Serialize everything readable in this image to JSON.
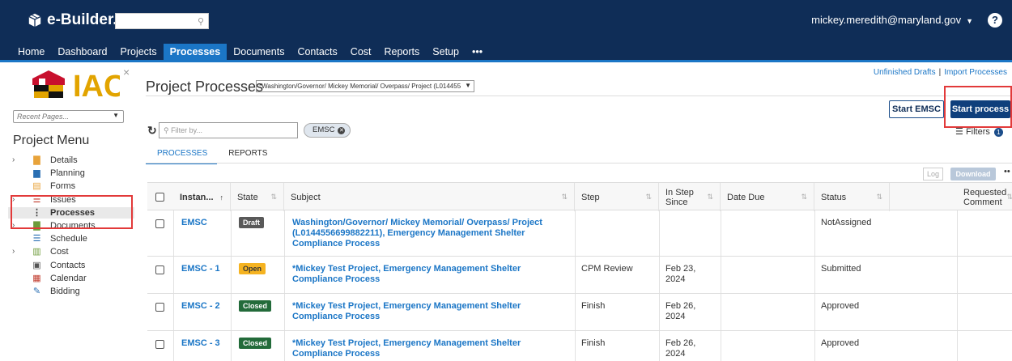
{
  "topbar": {
    "brand": "e-Builder.",
    "user": "mickey.meredith@maryland.gov",
    "help": "?"
  },
  "nav": {
    "tabs": [
      "Home",
      "Dashboard",
      "Projects",
      "Processes",
      "Documents",
      "Contacts",
      "Cost",
      "Reports",
      "Setup",
      "•••"
    ],
    "active": "Processes"
  },
  "sidebar": {
    "logo_text": "IAC",
    "recent_placeholder": "Recent Pages...",
    "menu_title": "Project Menu",
    "items": [
      {
        "label": "Details",
        "expandable": true,
        "icon": "folder-icon"
      },
      {
        "label": "Planning",
        "expandable": false,
        "icon": "planning-icon"
      },
      {
        "label": "Forms",
        "expandable": false,
        "icon": "forms-icon"
      },
      {
        "label": "Issues",
        "expandable": true,
        "icon": "issues-icon"
      },
      {
        "label": "Processes",
        "expandable": false,
        "icon": "processes-icon",
        "active": true
      },
      {
        "label": "Documents",
        "expandable": true,
        "icon": "documents-icon"
      },
      {
        "label": "Schedule",
        "expandable": false,
        "icon": "schedule-icon"
      },
      {
        "label": "Cost",
        "expandable": true,
        "icon": "cost-icon"
      },
      {
        "label": "Contacts",
        "expandable": false,
        "icon": "contacts-icon"
      },
      {
        "label": "Calendar",
        "expandable": false,
        "icon": "calendar-icon"
      },
      {
        "label": "Bidding",
        "expandable": false,
        "icon": "bidding-icon"
      }
    ]
  },
  "main": {
    "links": {
      "drafts": "Unfinished Drafts",
      "import": "Import Processes"
    },
    "title": "Project Processes",
    "project_select": "*Washington/Governor/ Mickey Memorial/ Overpass/ Project (L014455",
    "btn_start_emsc": "Start EMSC",
    "btn_start_process": "Start process",
    "filters_label": "Filters",
    "filters_count": "1",
    "filter_placeholder": "Filter by...",
    "chip_label": "EMSC",
    "subtabs": [
      "PROCESSES",
      "REPORTS"
    ],
    "btn_log": "Log",
    "btn_download": "Download",
    "more": "••"
  },
  "table": {
    "columns": [
      "Instan...",
      "State",
      "Subject",
      "Step",
      "In Step Since",
      "Date Due",
      "Status",
      "Requested Comment"
    ],
    "rows": [
      {
        "instance": "EMSC",
        "state": "Draft",
        "subject": "Washington/Governor/ Mickey Memorial/ Overpass/ Project (L0144556699882211), Emergency Management Shelter Compliance Process",
        "step": "",
        "since": "",
        "due": "",
        "status": "NotAssigned",
        "comment": ""
      },
      {
        "instance": "EMSC - 1",
        "state": "Open",
        "subject": "*Mickey Test Project, Emergency Management Shelter Compliance Process",
        "step": "CPM Review",
        "since": "Feb 23, 2024",
        "due": "",
        "status": "Submitted",
        "comment": ""
      },
      {
        "instance": "EMSC - 2",
        "state": "Closed",
        "subject": "*Mickey Test Project, Emergency Management Shelter Compliance Process",
        "step": "Finish",
        "since": "Feb 26, 2024",
        "due": "",
        "status": "Approved",
        "comment": ""
      },
      {
        "instance": "EMSC - 3",
        "state": "Closed",
        "subject": "*Mickey Test Project, Emergency Management Shelter Compliance Process",
        "step": "Finish",
        "since": "Feb 26, 2024",
        "due": "",
        "status": "Approved",
        "comment": ""
      }
    ]
  },
  "colors": {
    "navy": "#0f2d57",
    "accent": "#1b76c6",
    "highlight": "#e23a3a"
  }
}
